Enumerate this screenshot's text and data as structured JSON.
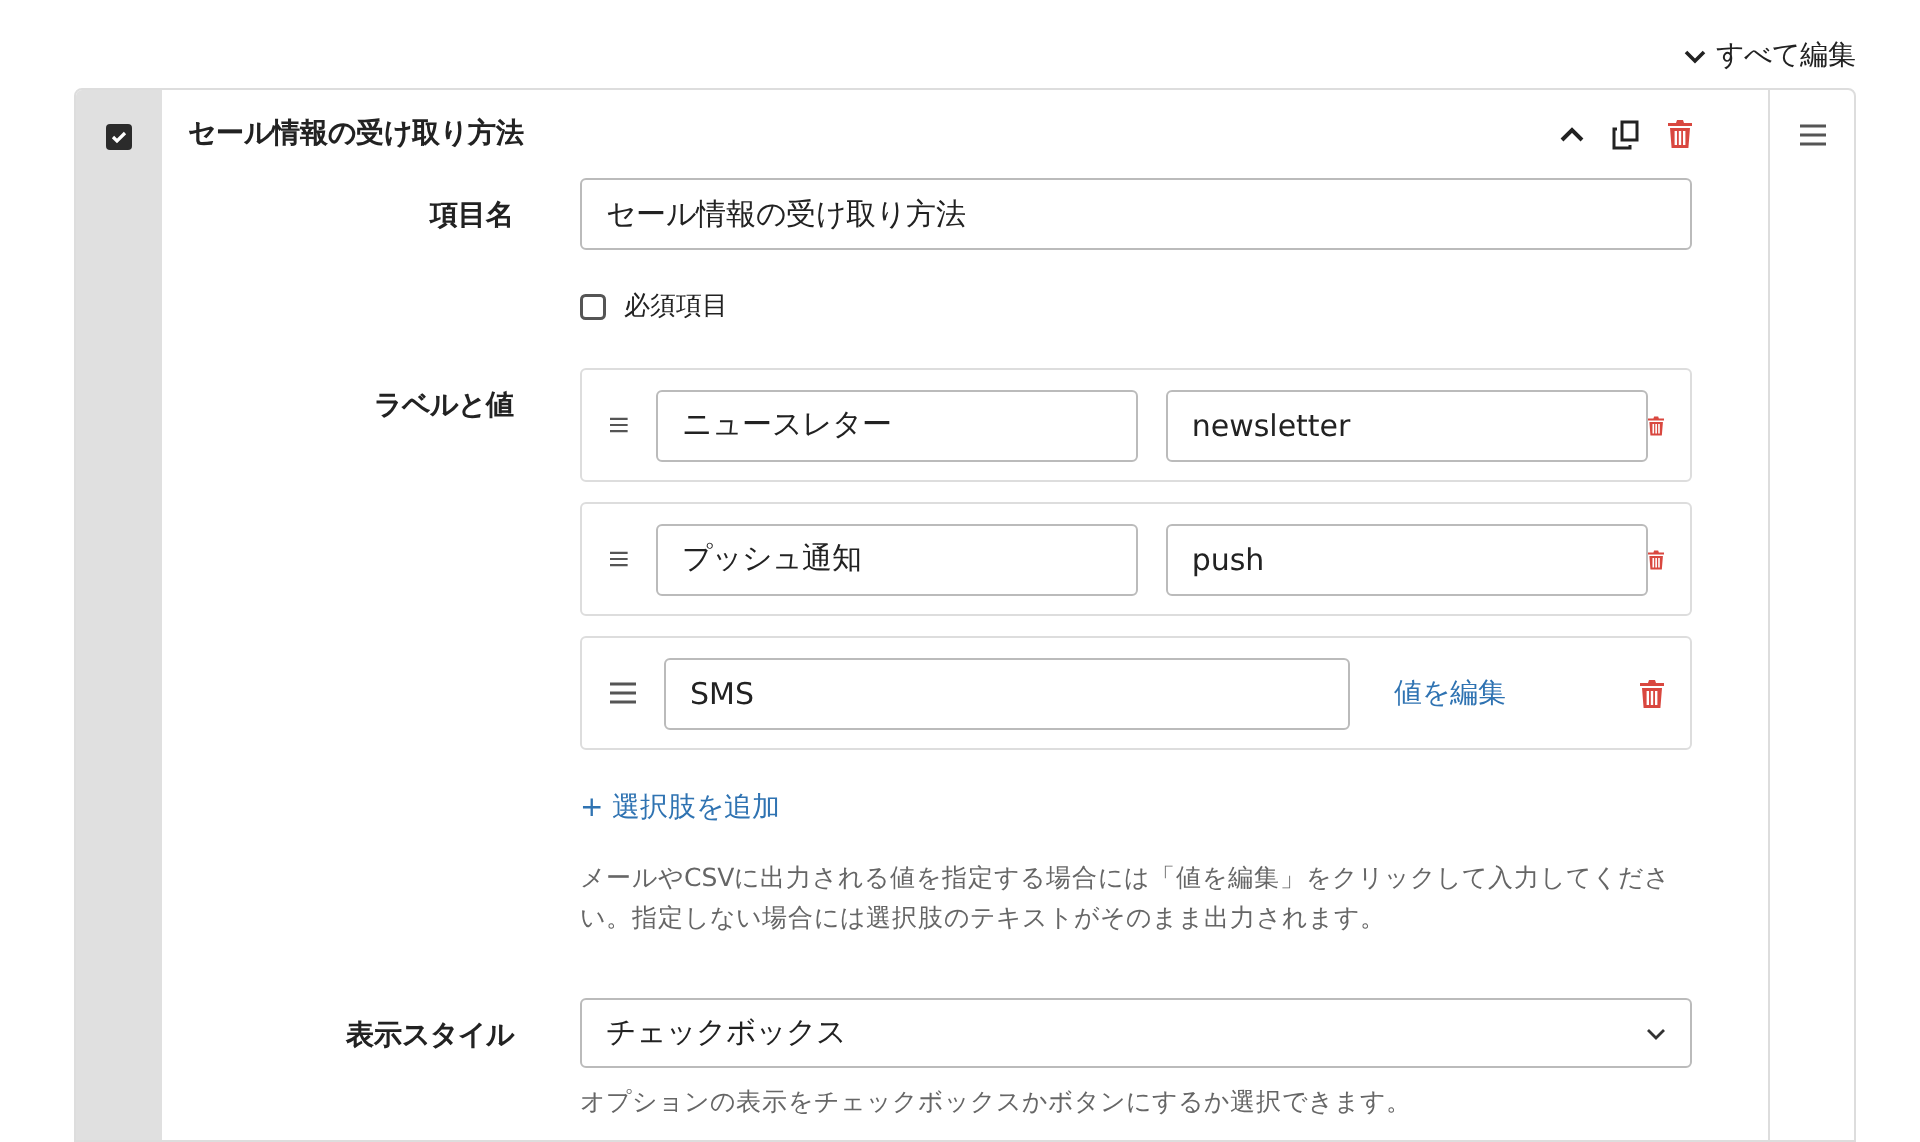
{
  "toolbar": {
    "edit_all": "すべて編集"
  },
  "field": {
    "checked": true,
    "title": "セール情報の受け取り方法",
    "name_label": "項目名",
    "name_value": "セール情報の受け取り方法",
    "required": {
      "label": "必須項目",
      "checked": false
    },
    "options_label": "ラベルと値",
    "options": [
      {
        "label": "ニュースレター",
        "kind": "value_field",
        "value": "newsletter"
      },
      {
        "label": "プッシュ通知",
        "kind": "value_field",
        "value": "push"
      },
      {
        "label": "SMS",
        "kind": "edit_link",
        "value": "値を編集"
      }
    ],
    "add_option": "+ 選択肢を追加",
    "options_help": "メールやCSVに出力される値を指定する場合には「値を編集」をクリックして入力してください。指定しない場合には選択肢のテキストがそのまま出力されます。",
    "style_label": "表示スタイル",
    "style_value": "チェックボックス",
    "style_help": "オプションの表示をチェックボックスかボタンにするか選択できます。"
  }
}
